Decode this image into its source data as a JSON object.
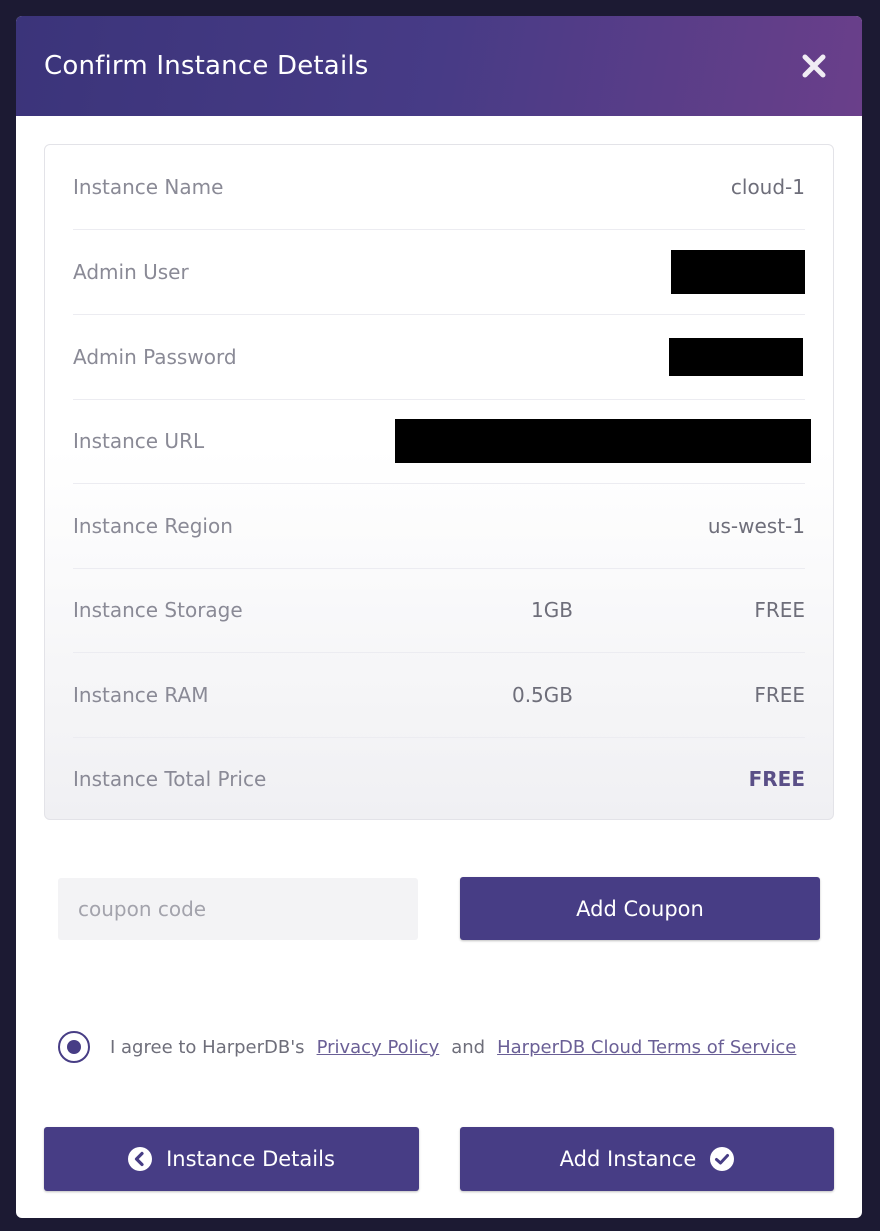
{
  "modal": {
    "title": "Confirm Instance Details",
    "close_icon": "close-icon"
  },
  "details": {
    "instance_name": {
      "label": "Instance Name",
      "value": "cloud-1"
    },
    "admin_user": {
      "label": "Admin User",
      "value": "[redacted]"
    },
    "admin_password": {
      "label": "Admin Password",
      "value": "[redacted]"
    },
    "instance_url": {
      "label": "Instance URL",
      "value": "[redacted]"
    },
    "instance_region": {
      "label": "Instance Region",
      "value": "us-west-1"
    },
    "instance_storage": {
      "label": "Instance Storage",
      "size": "1GB",
      "price": "FREE"
    },
    "instance_ram": {
      "label": "Instance RAM",
      "size": "0.5GB",
      "price": "FREE"
    },
    "total_price": {
      "label": "Instance Total Price",
      "price": "FREE"
    }
  },
  "coupon": {
    "placeholder": "coupon code",
    "value": "",
    "button_label": "Add Coupon"
  },
  "agreement": {
    "checked": true,
    "prefix": "I agree to HarperDB's",
    "privacy_link": "Privacy Policy",
    "conjunction": "and",
    "terms_link": "HarperDB Cloud Terms of Service"
  },
  "footer": {
    "back_label": "Instance Details",
    "back_icon": "chevron-left-circle-icon",
    "add_label": "Add Instance",
    "add_icon": "check-circle-icon"
  },
  "colors": {
    "accent": "#473d85",
    "header_start": "#3b347a",
    "header_end": "#6a3f8a",
    "backdrop": "#1c1a33"
  }
}
